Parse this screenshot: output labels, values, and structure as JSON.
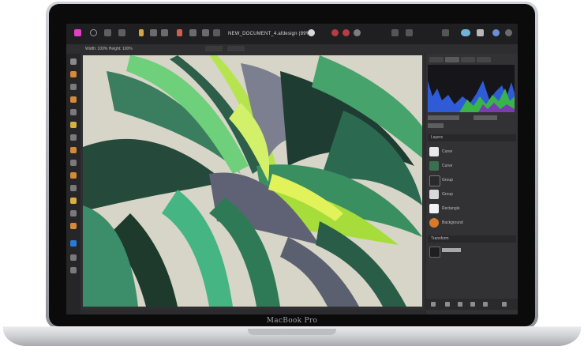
{
  "device": {
    "brand_label": "MacBook Pro"
  },
  "app": {
    "document_title": "NEW_DOCUMENT_4.afdesign (89%)",
    "context_bar_text": "Width: 100%  Height: 100%",
    "canvas_image": "abstract green-leaf artwork"
  },
  "toolbar": {
    "icons": [
      "app-icon",
      "persona-icon",
      "designer-icon",
      "export-icon",
      "undo-icon",
      "redo-icon",
      "snapping-icon",
      "align-icon",
      "boolean-icon",
      "arrange-icon",
      "insert-icon",
      "view-icon"
    ]
  },
  "layers_panel": {
    "section_label": "Layers",
    "rows": [
      {
        "label": "Curve"
      },
      {
        "label": "Curve"
      },
      {
        "label": "Group"
      },
      {
        "label": "Group"
      },
      {
        "label": "Rectangle"
      },
      {
        "label": "Background"
      }
    ],
    "footer_label": "Transform"
  },
  "colors": {
    "accent_magenta": "#e23fc6",
    "toolbar_bg": "#1f1f21",
    "panel_bg": "#323234"
  }
}
